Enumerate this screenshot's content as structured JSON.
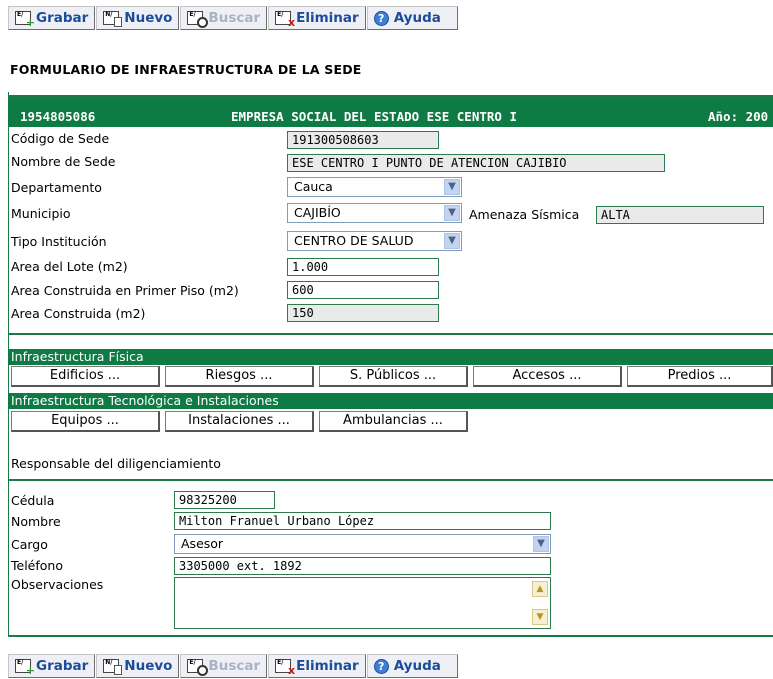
{
  "toolbar": {
    "grabar": "Grabar",
    "nuevo": "Nuevo",
    "buscar": "Buscar",
    "eliminar": "Eliminar",
    "ayuda": "Ayuda"
  },
  "form_title": "FORMULARIO DE INFRAESTRUCTURA DE LA SEDE",
  "header": {
    "code": "1954805086",
    "entity": "EMPRESA SOCIAL DEL ESTADO ESE CENTRO I",
    "year": "Año: 200"
  },
  "fields": {
    "codigo_sede": {
      "label": "Código de Sede",
      "value": "191300508603"
    },
    "nombre_sede": {
      "label": "Nombre de Sede",
      "value": "ESE CENTRO I PUNTO DE ATENCION CAJIBIO"
    },
    "departamento": {
      "label": "Departamento",
      "value": "Cauca"
    },
    "municipio": {
      "label": "Municipio",
      "value": "CAJIBÍO"
    },
    "amenaza": {
      "label": "Amenaza Sísmica",
      "value": "ALTA"
    },
    "tipo_institucion": {
      "label": "Tipo Institución",
      "value": "CENTRO DE SALUD"
    },
    "area_lote": {
      "label": "Area del Lote (m2)",
      "value": "1.000"
    },
    "area_primer_piso": {
      "label": "Area Construida en Primer Piso (m2)",
      "value": "600"
    },
    "area_construida": {
      "label": "Area Construida (m2)",
      "value": "150"
    }
  },
  "infra_fisica": {
    "title": "Infraestructura Física",
    "buttons": [
      "Edificios ...",
      "Riesgos ...",
      "S. Públicos ...",
      "Accesos ...",
      "Predios ..."
    ]
  },
  "infra_tec": {
    "title": "Infraestructura Tecnológica e Instalaciones",
    "buttons": [
      "Equipos ...",
      "Instalaciones ...",
      "Ambulancias ..."
    ]
  },
  "responsable": {
    "heading": "Responsable del diligenciamiento",
    "cedula": {
      "label": "Cédula",
      "value": "98325200"
    },
    "nombre": {
      "label": "Nombre",
      "value": "Milton Franuel Urbano López"
    },
    "cargo": {
      "label": "Cargo",
      "value": "Asesor"
    },
    "telefono": {
      "label": "Teléfono",
      "value": "3305000 ext. 1892"
    },
    "observaciones": {
      "label": "Observaciones",
      "value": ""
    }
  },
  "colors": {
    "header_green": "#0e7a44",
    "toolbar_text": "#1c4c9a"
  }
}
